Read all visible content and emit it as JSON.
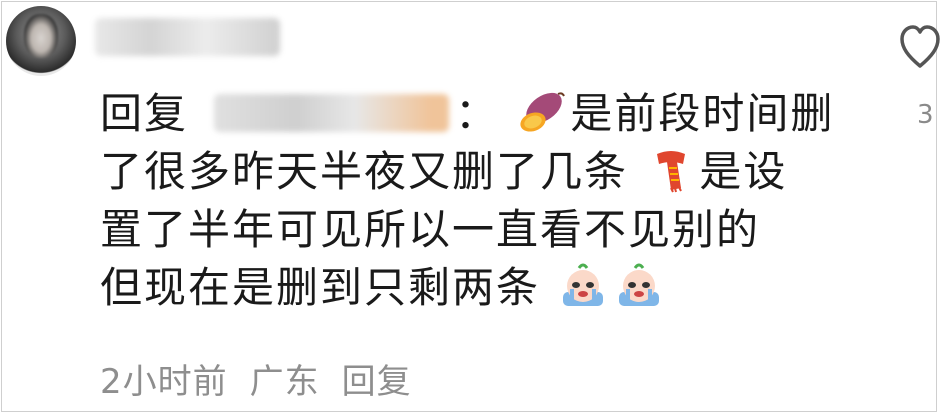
{
  "comment": {
    "reply_prefix": "回复",
    "colon": "：",
    "lines": [
      "是前段时间删",
      "了很多昨天半夜又删了几条",
      "是设",
      "置了半年可见所以一直看不见别的",
      "但现在是删到只剩两条"
    ],
    "emojis": [
      "sweet-potato-icon",
      "scarf-icon",
      "crying-face-icon",
      "crying-face-icon"
    ]
  },
  "like": {
    "count": "3"
  },
  "meta": {
    "time": "2小时前",
    "location": "广东",
    "reply_label": "回复"
  }
}
